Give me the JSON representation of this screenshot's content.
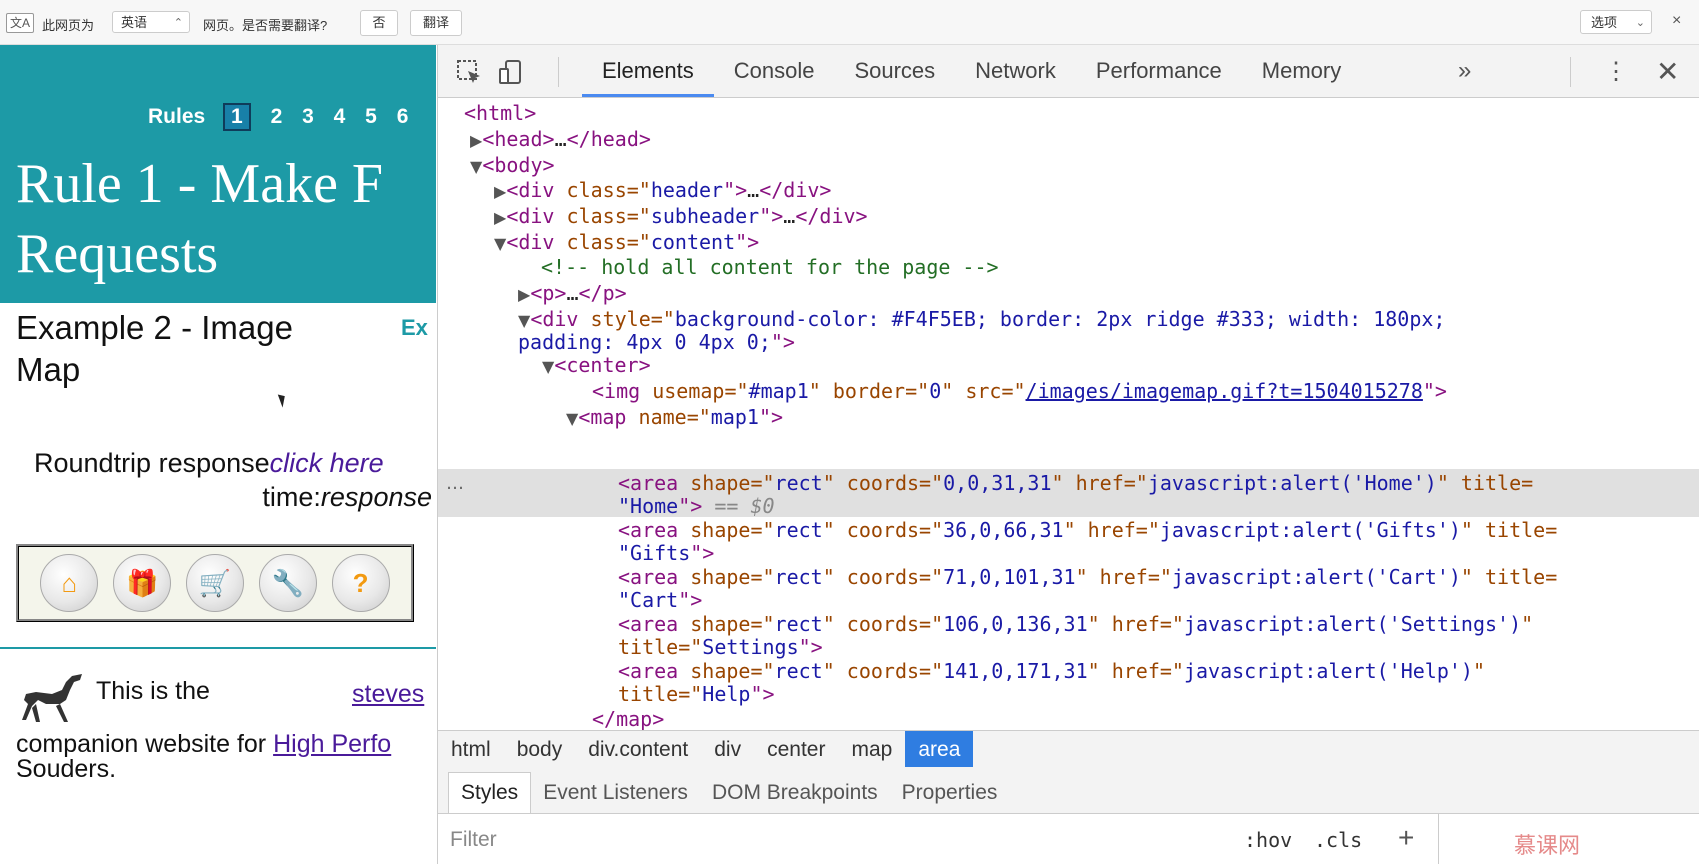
{
  "translate_bar": {
    "icon_label": "文A",
    "text1": "此网页为",
    "language": "英语",
    "language_updown": "⌃",
    "text2": "网页。是否需要翻译?",
    "no_label": "否",
    "translate_label": "翻译",
    "options_label": "选项",
    "options_chevron": "⌄",
    "close_label": "×"
  },
  "page": {
    "rules_label": "Rules",
    "rule_pages": [
      "1",
      "2",
      "3",
      "4",
      "5",
      "6"
    ],
    "current_rule_page": "1",
    "title_line1": "Rule 1 - Make F",
    "title_line2": "Requests",
    "example_title_line1": "Example 2 - Image",
    "example_title_line2": "Map",
    "example_right_label": "Ex",
    "roundtrip_label": "Roundtrip response",
    "click_here_label": "click here",
    "time_label": "time:",
    "response_label": "response",
    "this_is_the": "This is the",
    "steves_link": "steves",
    "companion_text": "companion website for ",
    "high_perf_link": "High Perfo",
    "souders_text": "Souders.",
    "map_buttons": [
      {
        "icon": "home-icon",
        "glyph": "⌂"
      },
      {
        "icon": "gift-icon",
        "glyph": "🎁"
      },
      {
        "icon": "cart-icon",
        "glyph": "🛒"
      },
      {
        "icon": "settings-icon",
        "glyph": "🔧"
      },
      {
        "icon": "help-icon",
        "glyph": "?"
      }
    ]
  },
  "devtools": {
    "tabs": [
      "Elements",
      "Console",
      "Sources",
      "Network",
      "Performance",
      "Memory"
    ],
    "active_tab": "Elements",
    "more_label": "»",
    "menu_label": "⋮",
    "close_label": "✕",
    "tree": {
      "html_open": "<html>",
      "head_open": "<head>",
      "ellipsis": "…",
      "head_close": "</head>",
      "body_open": "<body>",
      "div_open": "<div ",
      "div_end": "\">",
      "div_close": "</div>",
      "class_attr": "class=\"",
      "header_val": "header",
      "subheader_val": "subheader",
      "content_val": "content",
      "comment": "<!-- hold all content for the page -->",
      "p_open": "<p>",
      "p_close": "</p>",
      "style_attr": "style=\"",
      "style_val_1": "background-color: #F4F5EB; border: 2px ridge #333; width: 180px;",
      "style_val_2": "padding: 4px 0 4px 0;",
      "center_open": "<center>",
      "img_open": "<img ",
      "usemap_attr": "usemap=\"",
      "usemap_val": "#map1",
      "border_attr": "\" border=\"",
      "border_val": "0",
      "src_attr": "\" src=\"",
      "src_val": "/images/imagemap.gif?t=1504015278",
      "map_open": "<map ",
      "name_attr": "name=\"",
      "name_val": "map1",
      "area_open": "<area ",
      "shape_attr": "shape=\"",
      "shape_val": "rect",
      "coords_attr": "\" coords=\"",
      "href_attr": "\" href=\"",
      "title_attr": "title=",
      "title_attr_full": "title=\"",
      "areas": [
        {
          "coords": "0,0,31,31",
          "href": "javascript:alert('Home')",
          "title": "Home"
        },
        {
          "coords": "36,0,66,31",
          "href": "javascript:alert('Gifts')",
          "title": "Gifts"
        },
        {
          "coords": "71,0,101,31",
          "href": "javascript:alert('Cart')",
          "title": "Cart"
        },
        {
          "coords": "106,0,136,31",
          "href": "javascript:alert('Settings')",
          "title": "Settings"
        },
        {
          "coords": "141,0,171,31",
          "href": "javascript:alert('Help')",
          "title": "Help"
        }
      ],
      "selected_marker": "== $0",
      "row_dots": "…",
      "quote": "\"",
      "quote_end": "\"",
      "quote_close": "\">",
      "map_close": "</map>"
    },
    "breadcrumbs": [
      "html",
      "body",
      "div.content",
      "div",
      "center",
      "map",
      "area"
    ],
    "active_breadcrumb": "area",
    "sub_tabs": [
      "Styles",
      "Event Listeners",
      "DOM Breakpoints",
      "Properties"
    ],
    "active_sub_tab": "Styles",
    "filter_placeholder": "Filter",
    "hov_label": ":hov",
    "cls_label": ".cls",
    "add_rule_label": "+",
    "watermark": "慕课网"
  }
}
